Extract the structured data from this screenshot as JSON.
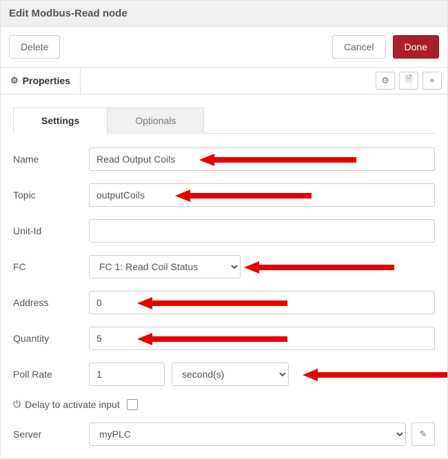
{
  "header": {
    "title": "Edit Modbus-Read node"
  },
  "actions": {
    "delete": "Delete",
    "cancel": "Cancel",
    "done": "Done"
  },
  "tray": {
    "properties": "Properties"
  },
  "tabs": {
    "settings": "Settings",
    "optionals": "Optionals"
  },
  "labels": {
    "name": "Name",
    "topic": "Topic",
    "unitid": "Unit-Id",
    "fc": "FC",
    "address": "Address",
    "quantity": "Quantity",
    "pollrate": "Poll Rate",
    "delay": "Delay to activate input",
    "server": "Server"
  },
  "values": {
    "name": "Read Output Coils",
    "topic": "outputCoils",
    "unitid": "",
    "fc": "FC 1: Read Coil Status",
    "address": "0",
    "quantity": "5",
    "pollrate_value": "1",
    "pollrate_unit": "second(s)",
    "server": "myPLC"
  },
  "icons": {
    "gear": "⚙",
    "doc": "🗎",
    "scope": "⌖",
    "power": "⏻",
    "pencil": "✎"
  }
}
